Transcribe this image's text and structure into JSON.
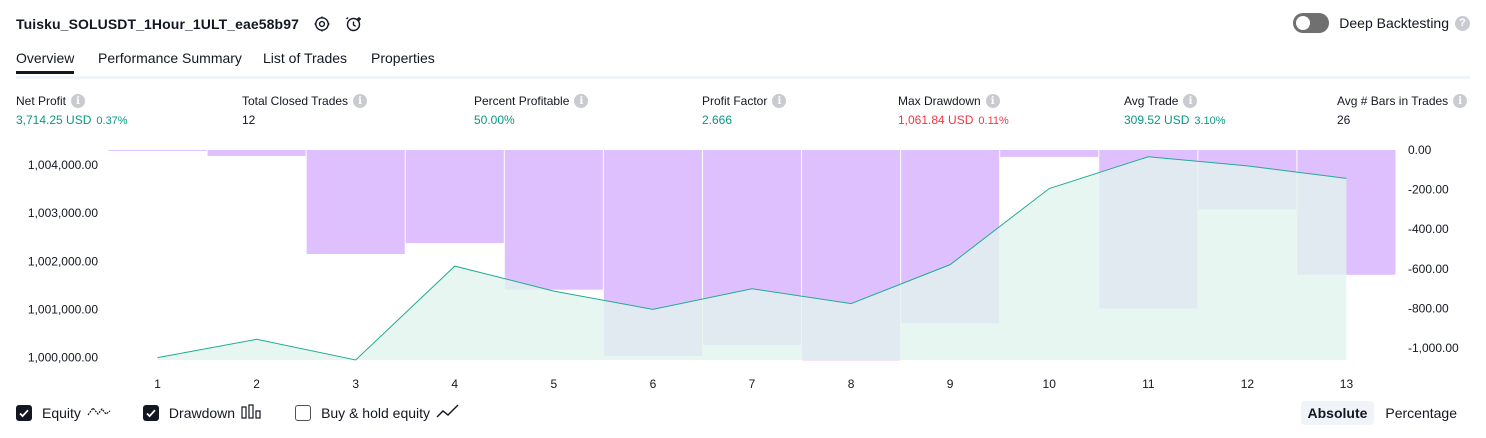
{
  "header": {
    "title": "Tuisku_SOLUSDT_1Hour_1ULT_eae58b97"
  },
  "deep_backtesting": {
    "label": "Deep Backtesting",
    "help": "?"
  },
  "tabs": [
    {
      "label": "Overview"
    },
    {
      "label": "Performance Summary"
    },
    {
      "label": "List of Trades"
    },
    {
      "label": "Properties"
    }
  ],
  "metrics": [
    {
      "label": "Net Profit",
      "value": "3,714.25 USD",
      "pct": "0.37%"
    },
    {
      "label": "Total Closed Trades",
      "value": "12"
    },
    {
      "label": "Percent Profitable",
      "value": "50.00%"
    },
    {
      "label": "Profit Factor",
      "value": "2.666"
    },
    {
      "label": "Max Drawdown",
      "value": "1,061.84 USD",
      "pct": "0.11%"
    },
    {
      "label": "Avg Trade",
      "value": "309.52 USD",
      "pct": "3.10%"
    },
    {
      "label": "Avg # Bars in Trades",
      "value": "26"
    }
  ],
  "info_glyph": "i",
  "legend": [
    {
      "label": "Equity",
      "checked": true,
      "icon": "equity-line-icon"
    },
    {
      "label": "Drawdown",
      "checked": true,
      "icon": "drawdown-bars-icon"
    },
    {
      "label": "Buy & hold equity",
      "checked": false,
      "icon": "buy-hold-line-icon"
    }
  ],
  "modes": [
    {
      "label": "Absolute",
      "active": true
    },
    {
      "label": "Percentage",
      "active": false
    }
  ],
  "colors": {
    "equity_line": "#22ab94",
    "equity_fill": "#e2f4ee",
    "drawdown_fill": "#d1a5fd",
    "positive": "#089981",
    "negative": "#f23645"
  },
  "chart_data": {
    "type": "line",
    "x": [
      1,
      2,
      3,
      4,
      5,
      6,
      7,
      8,
      9,
      10,
      11,
      12,
      13
    ],
    "series": [
      {
        "name": "Equity",
        "axis": "left",
        "values": [
          1000000,
          1000380,
          999950,
          1001900,
          1001380,
          1001000,
          1001430,
          1001120,
          1001930,
          1003510,
          1004170,
          1003980,
          1003720
        ]
      },
      {
        "name": "Drawdown",
        "axis": "right",
        "kind": "bar",
        "values": [
          -5,
          -30,
          -525,
          -470,
          -705,
          -1040,
          -985,
          -1062,
          -875,
          -35,
          -800,
          -300,
          -630
        ]
      }
    ],
    "left_ticks": [
      "1,000,000.00",
      "1,001,000.00",
      "1,002,000.00",
      "1,003,000.00",
      "1,004,000.00"
    ],
    "left_tick_values": [
      1000000,
      1001000,
      1002000,
      1003000,
      1004000
    ],
    "right_ticks": [
      "0.00",
      "-200.00",
      "-400.00",
      "-600.00",
      "-800.00",
      "-1,000.00"
    ],
    "right_tick_values": [
      0,
      -200,
      -400,
      -600,
      -800,
      -1000
    ],
    "x_ticks": [
      "1",
      "2",
      "3",
      "4",
      "5",
      "6",
      "7",
      "8",
      "9",
      "10",
      "11",
      "12",
      "13"
    ],
    "ylim_left": [
      999950,
      1004310
    ],
    "ylim_right": [
      -1060,
      0
    ],
    "grid": false
  }
}
